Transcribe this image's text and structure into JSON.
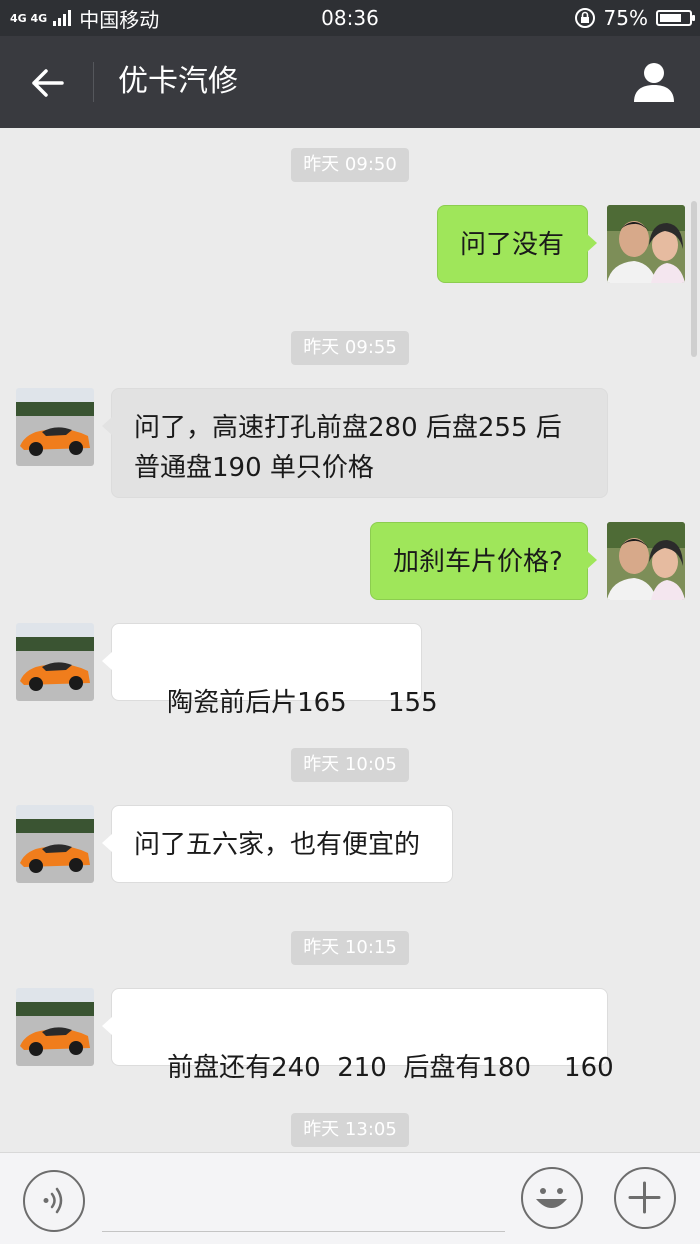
{
  "status_bar": {
    "network": "4G 4G",
    "carrier": "中国移动",
    "time": "08:36",
    "battery": "75%",
    "battery_level": 0.75
  },
  "header": {
    "title": "优卡汽修"
  },
  "messages": [
    {
      "kind": "time",
      "text": "昨天 09:50"
    },
    {
      "kind": "sent",
      "text": "问了没有"
    },
    {
      "kind": "time",
      "text": "昨天 09:55"
    },
    {
      "kind": "received",
      "text": "问了，高速打孔前盘280  后盘255  后普通盘190  单只价格"
    },
    {
      "kind": "sent",
      "text": "加刹车片价格?"
    },
    {
      "kind": "received",
      "text": "陶瓷前后片165     155"
    },
    {
      "kind": "time",
      "text": "昨天 10:05"
    },
    {
      "kind": "received",
      "text": "问了五六家，也有便宜的"
    },
    {
      "kind": "time",
      "text": "昨天 10:15"
    },
    {
      "kind": "received",
      "text": "前盘还有240  210  后盘有180    160"
    },
    {
      "kind": "time",
      "text": "昨天 13:05"
    }
  ],
  "colors": {
    "sent_bubble": "#9fe65a",
    "received_bubble": "#ffffff",
    "header": "#393a3f",
    "background": "#ebebeb"
  },
  "input_bar": {
    "voice_icon": "voice-icon",
    "emoji_icon": "emoji-icon",
    "add_icon": "plus-icon"
  }
}
